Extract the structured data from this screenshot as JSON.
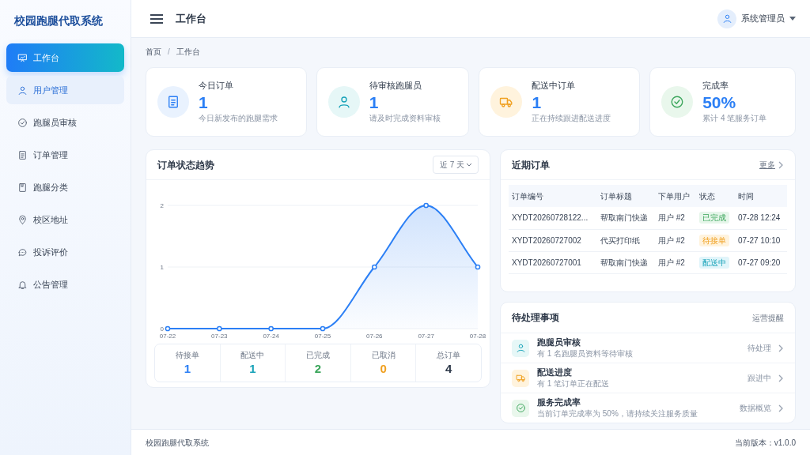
{
  "sidebar": {
    "logo": "校园跑腿代取系统",
    "items": [
      {
        "label": "工作台",
        "kind": "dashboard",
        "selected": true,
        "hovered": false
      },
      {
        "label": "用户管理",
        "kind": "user",
        "selected": false,
        "hovered": true
      },
      {
        "label": "跑腿员审核",
        "kind": "check",
        "selected": false,
        "hovered": false
      },
      {
        "label": "订单管理",
        "kind": "doc",
        "selected": false,
        "hovered": false
      },
      {
        "label": "跑腿分类",
        "kind": "book",
        "selected": false,
        "hovered": false
      },
      {
        "label": "校区地址",
        "kind": "pin",
        "selected": false,
        "hovered": false
      },
      {
        "label": "投诉评价",
        "kind": "chat",
        "selected": false,
        "hovered": false
      },
      {
        "label": "公告管理",
        "kind": "bell",
        "selected": false,
        "hovered": false
      }
    ]
  },
  "header": {
    "title": "工作台",
    "user": "系统管理员"
  },
  "breadcrumb": {
    "separator": "/",
    "items": [
      "首页",
      "工作台"
    ]
  },
  "stats": [
    {
      "kind": "doc",
      "label": "今日订单",
      "value": "1",
      "note": "今日新发布的跑腿需求"
    },
    {
      "kind": "user",
      "label": "待审核跑腿员",
      "value": "1",
      "note": "请及时完成资料审核"
    },
    {
      "kind": "truck",
      "label": "配送中订单",
      "value": "1",
      "note": "正在持续跟进配送进度"
    },
    {
      "kind": "check",
      "label": "完成率",
      "value": "50%",
      "note": "累计 4 笔服务订单"
    }
  ],
  "trend": {
    "title": "订单状态趋势",
    "range": "近 7 天",
    "chart_data": {
      "type": "area",
      "categories": [
        "07-22",
        "07-23",
        "07-24",
        "07-25",
        "07-26",
        "07-27",
        "07-28"
      ],
      "series": [
        {
          "color": "#2b7ff5",
          "values": [
            0,
            0,
            0,
            0,
            1,
            2,
            1
          ]
        }
      ],
      "ylim": [
        0,
        2
      ],
      "yticks": [
        0,
        1,
        2
      ]
    },
    "summary": [
      {
        "label": "待接单",
        "value": "1",
        "color": "#2b7ff5"
      },
      {
        "label": "配送中",
        "value": "1",
        "color": "#17a2b8"
      },
      {
        "label": "已完成",
        "value": "2",
        "color": "#3aa55a"
      },
      {
        "label": "已取消",
        "value": "0",
        "color": "#f0a020"
      },
      {
        "label": "总订单",
        "value": "4",
        "color": "#2f3a4a"
      }
    ]
  },
  "recent": {
    "title": "近期订单",
    "more": "更多",
    "columns": [
      "订单编号",
      "订单标题",
      "下单用户",
      "状态",
      "时间"
    ],
    "rows": [
      {
        "id": "XYDT20260728122...",
        "title": "帮取南门快递",
        "user": "用户 #2",
        "status": "已完成",
        "kind": "completed",
        "time": "07-28 12:24"
      },
      {
        "id": "XYDT20260727002",
        "title": "代买打印纸",
        "user": "用户 #2",
        "status": "待接单",
        "kind": "pending",
        "time": "07-27 10:10"
      },
      {
        "id": "XYDT20260727001",
        "title": "帮取南门快递",
        "user": "用户 #2",
        "status": "配送中",
        "kind": "delivering",
        "time": "07-27 09:20"
      }
    ]
  },
  "todo": {
    "title": "待处理事项",
    "subtitle": "运营提醒",
    "items": [
      {
        "kind": "user",
        "title": "跑腿员审核",
        "desc": "有 1 名跑腿员资料等待审核",
        "action": "待处理"
      },
      {
        "kind": "truck",
        "title": "配送进度",
        "desc": "有 1 笔订单正在配送",
        "action": "跟进中"
      },
      {
        "kind": "check",
        "title": "服务完成率",
        "desc": "当前订单完成率为 50%，请持续关注服务质量",
        "action": "数据概览"
      }
    ]
  },
  "footer": {
    "left": "校园跑腿代取系统",
    "right": "当前版本：v1.0.0"
  }
}
